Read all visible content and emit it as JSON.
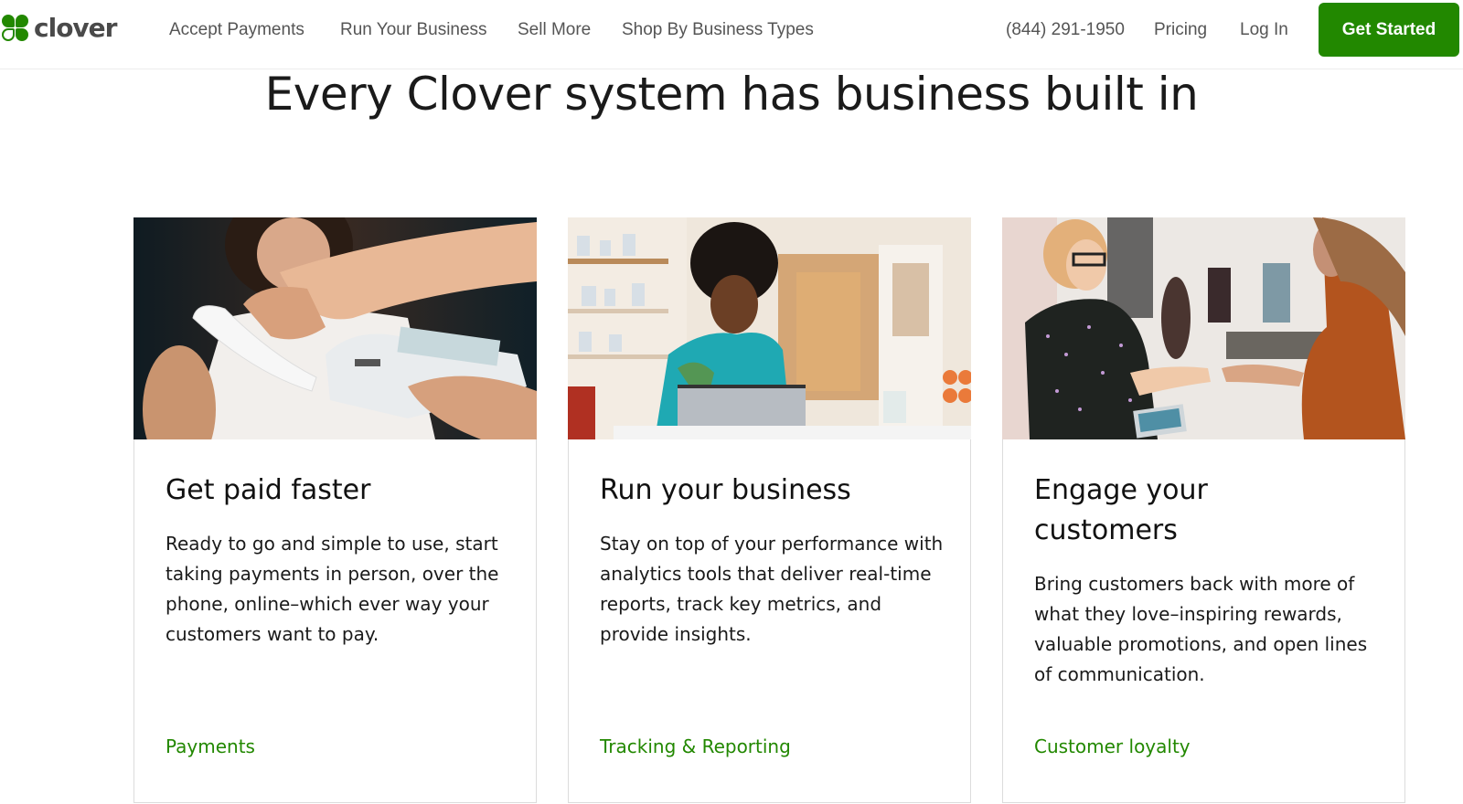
{
  "nav": {
    "logo_text": "clover",
    "links": [
      "Accept Payments",
      "Run Your Business",
      "Sell More",
      "Shop By Business Types"
    ],
    "phone": "(844) 291-1950",
    "pricing": "Pricing",
    "login": "Log In",
    "cta": "Get Started"
  },
  "headline": "Every Clover system has business built in",
  "brand_color": "#228800",
  "cards": [
    {
      "image": "photo-payment-terminal-receipt",
      "title": "Get paid faster",
      "body": "Ready to go and simple to use, start taking payments in person, over the phone, online–which ever way your customers want to pay.",
      "link": "Payments"
    },
    {
      "image": "photo-woman-laptop-cafe",
      "title": "Run your business",
      "body": "Stay on top of your performance with analytics tools that deliver real-time reports, track key metrics, and provide insights.",
      "link": "Tracking & Reporting"
    },
    {
      "image": "photo-salon-customer-handoff",
      "title": "Engage your customers",
      "body": "Bring customers back with more of what they love–inspiring rewards, valuable promotions, and open lines of communication.",
      "link": "Customer loyalty"
    }
  ]
}
